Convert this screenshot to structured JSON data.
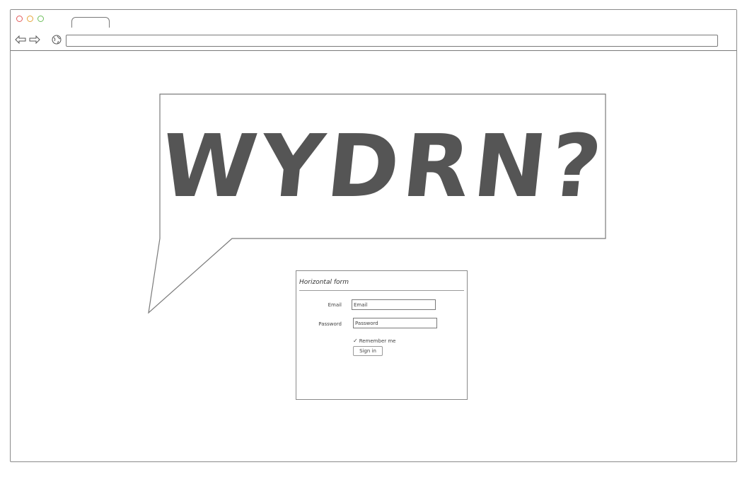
{
  "browser": {
    "tab_label": "",
    "url": ""
  },
  "logo": {
    "text": "WYDRN?"
  },
  "form": {
    "legend": "Horizontal form",
    "email_label": "Email",
    "email_value": "Email",
    "password_label": "Password",
    "password_value": "Password",
    "remember_label": "Remember me",
    "check_glyph": "✓",
    "signin_label": "Sign in"
  },
  "colors": {
    "stroke": "#7a7a7a",
    "logo": "#555555",
    "dot_red": "#e35b5b",
    "dot_yellow": "#e6a53a",
    "dot_green": "#6cbf5a"
  },
  "icons": [
    "back-arrow-icon",
    "forward-arrow-icon",
    "globe-icon"
  ]
}
